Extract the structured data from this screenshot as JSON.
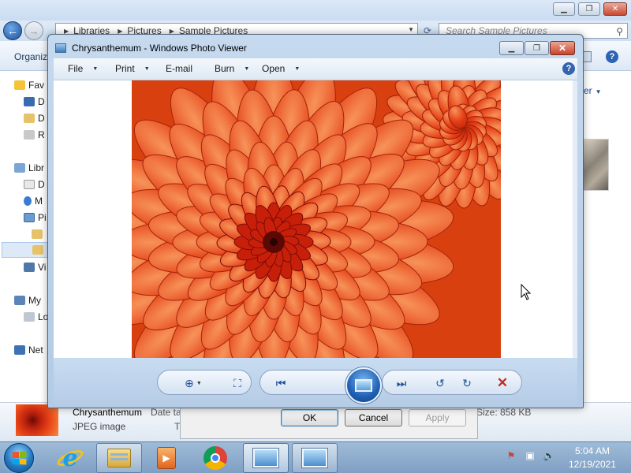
{
  "explorer": {
    "breadcrumb": [
      "Libraries",
      "Pictures",
      "Sample Pictures"
    ],
    "search_placeholder": "Search Sample Pictures",
    "organize_label": "Organiz",
    "nav_items": [
      "Fav",
      "D",
      "D",
      "R",
      "Libr",
      "D",
      "M",
      "Pi",
      "",
      "",
      "Vi",
      "My",
      "Lo",
      "Net"
    ],
    "right_pane_label": "er",
    "details": {
      "name": "Chrysanthemum",
      "type": "JPEG image",
      "date_label": "Date ta",
      "t_label": "T",
      "size": "Size: 858 KB"
    }
  },
  "dialog": {
    "ok": "OK",
    "cancel": "Cancel",
    "apply": "Apply"
  },
  "viewer": {
    "title": "Chrysanthemum - Windows Photo Viewer",
    "menus": [
      "File",
      "Print",
      "E-mail",
      "Burn",
      "Open"
    ],
    "help": "?",
    "controls": [
      "zoom",
      "actual-size",
      "previous",
      "slide-show",
      "next",
      "rotate-counterclockwise",
      "rotate-clockwise",
      "delete"
    ],
    "image_subject": "Chrysanthemum"
  },
  "taskbar": {
    "apps": [
      "internet-explorer",
      "windows-explorer",
      "windows-media-player",
      "google-chrome",
      "windows-photo-viewer",
      "windows-photo-viewer"
    ],
    "time": "5:04 AM",
    "date": "12/19/2021"
  },
  "colors": {
    "accent": "#1f5fb4",
    "flower_dark": "#5c0904",
    "flower_mid": "#e43d14",
    "flower_light": "#f7935a",
    "delete": "#c62b21"
  }
}
